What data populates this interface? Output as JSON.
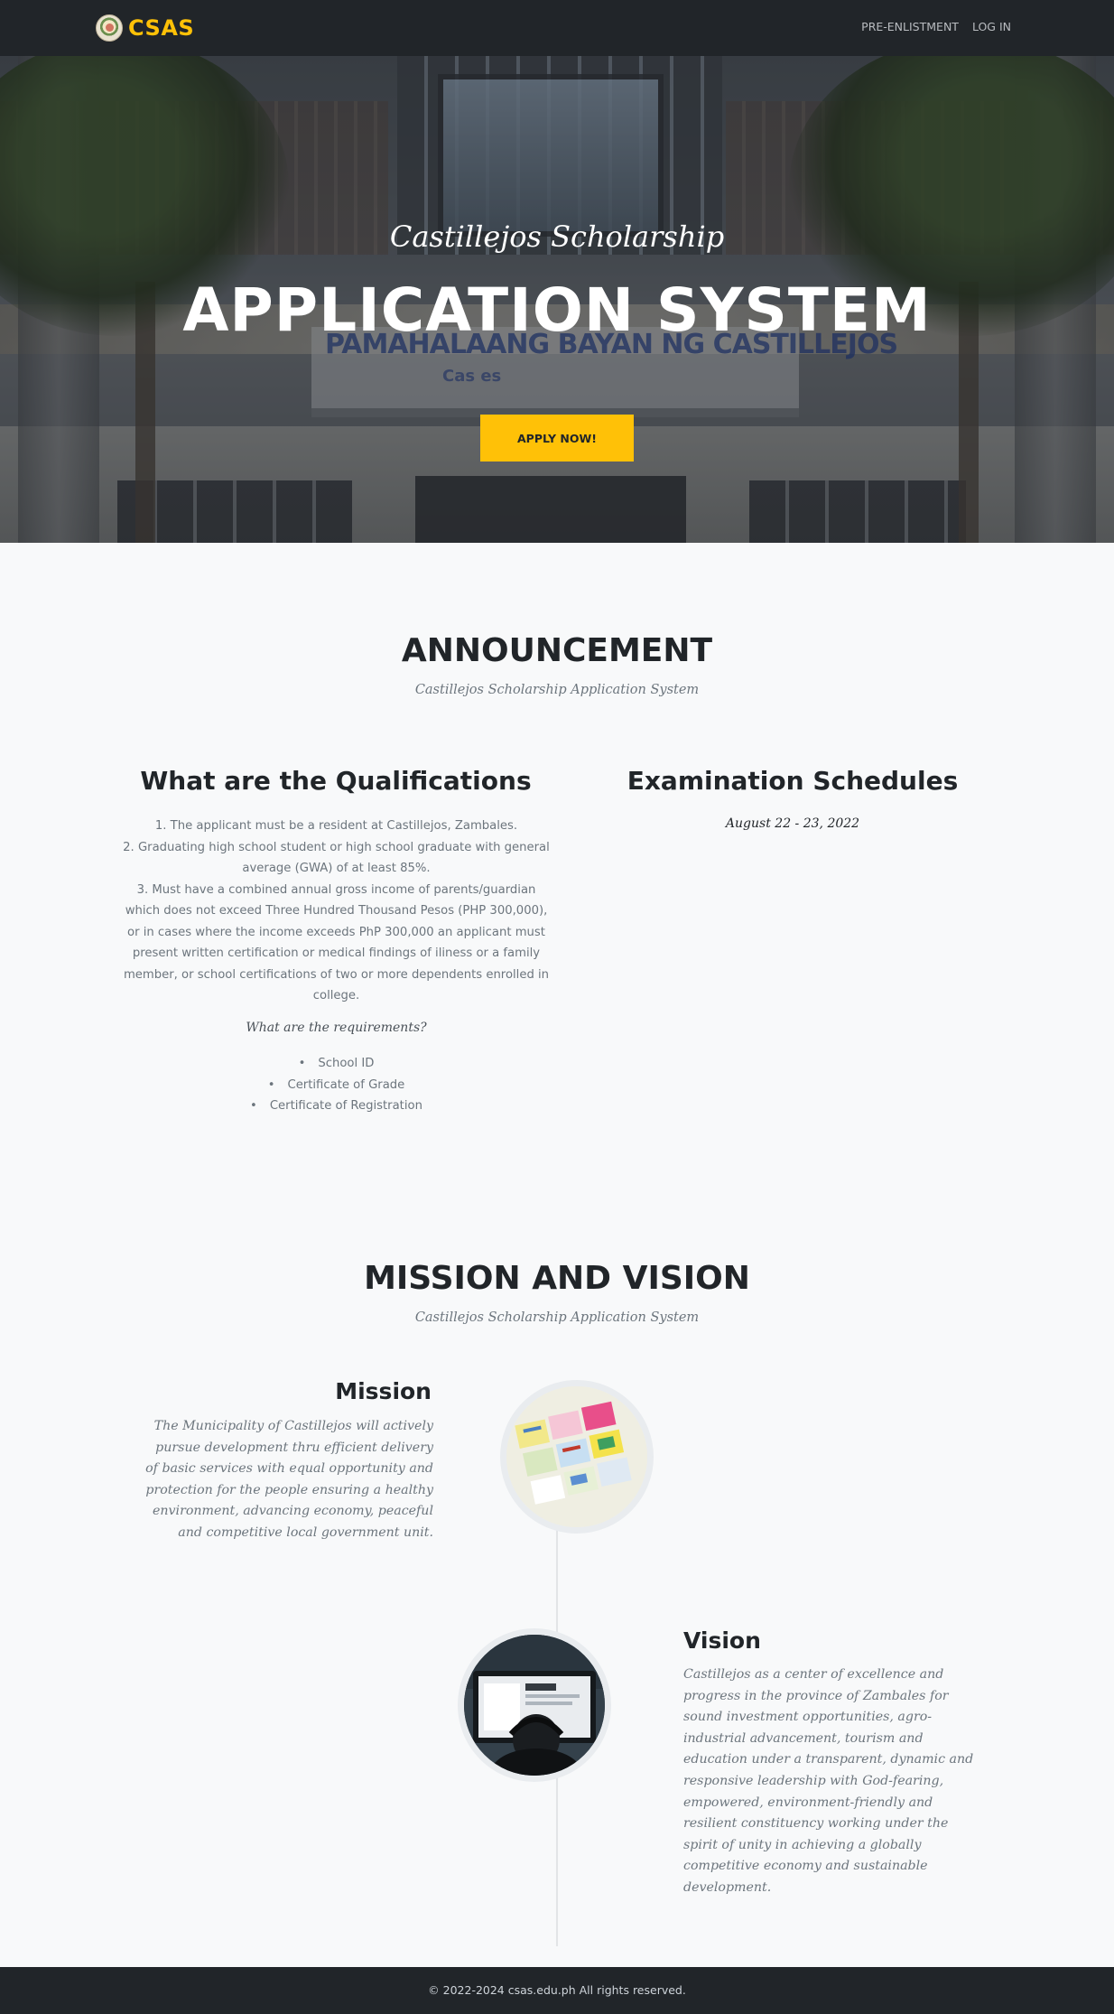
{
  "navbar": {
    "brand": "CSAS",
    "links": [
      "PRE-ENLISTMENT",
      "LOG IN"
    ]
  },
  "hero": {
    "subtitle": "Castillejos Scholarship",
    "title": "APPLICATION SYSTEM",
    "button": "APPLY NOW!",
    "sign_line1": "PAMAHALAANG BAYAN NG CASTILLEJOS",
    "sign_line2": "Cas               es"
  },
  "announcement": {
    "title": "ANNOUNCEMENT",
    "subtitle": "Castillejos Scholarship Application System",
    "qualifications": {
      "title": "What are the Qualifications",
      "items": [
        "1. The applicant must be a resident at Castillejos, Zambales.",
        "2. Graduating high school student or high school graduate with general average (GWA) of at least 85%.",
        "3. Must have a combined annual gross income of parents/guardian which does not exceed Three Hundred Thousand Pesos (PHP 300,000), or in cases where the income exceeds PhP 300,000 an applicant must present written certification or medical findings of iliness or a family member, or school certifications of two or more dependents enrolled in college."
      ],
      "requirements_title": "What are the requirements?",
      "requirements": [
        "School ID",
        "Certificate of Grade",
        "Certificate of Registration"
      ]
    },
    "exam": {
      "title": "Examination Schedules",
      "date": "August 22 - 23, 2022"
    }
  },
  "mission_vision": {
    "title": "MISSION AND VISION",
    "subtitle": "Castillejos Scholarship Application System",
    "mission": {
      "heading": "Mission",
      "text": "The Municipality of Castillejos will actively pursue development thru efficient delivery of basic services with equal opportunity and protection for the people ensuring a healthy environment, advancing economy, peaceful and competitive local government unit."
    },
    "vision": {
      "heading": "Vision",
      "text": "Castillejos as a center of excellence and progress in the province of Zambales for sound investment opportunities, agro-industrial advancement, tourism and education under a transparent, dynamic and responsive leadership with God-fearing, empowered, environment-friendly and resilient constituency working under the spirit of unity in achieving a globally competitive economy and sustainable development."
    }
  },
  "footer": {
    "text": "© 2022-2024 csas.edu.ph All rights reserved."
  },
  "colors": {
    "accent": "#ffc107",
    "dark": "#212529",
    "page_bg": "#f8f9fa",
    "muted": "#6c757d"
  }
}
